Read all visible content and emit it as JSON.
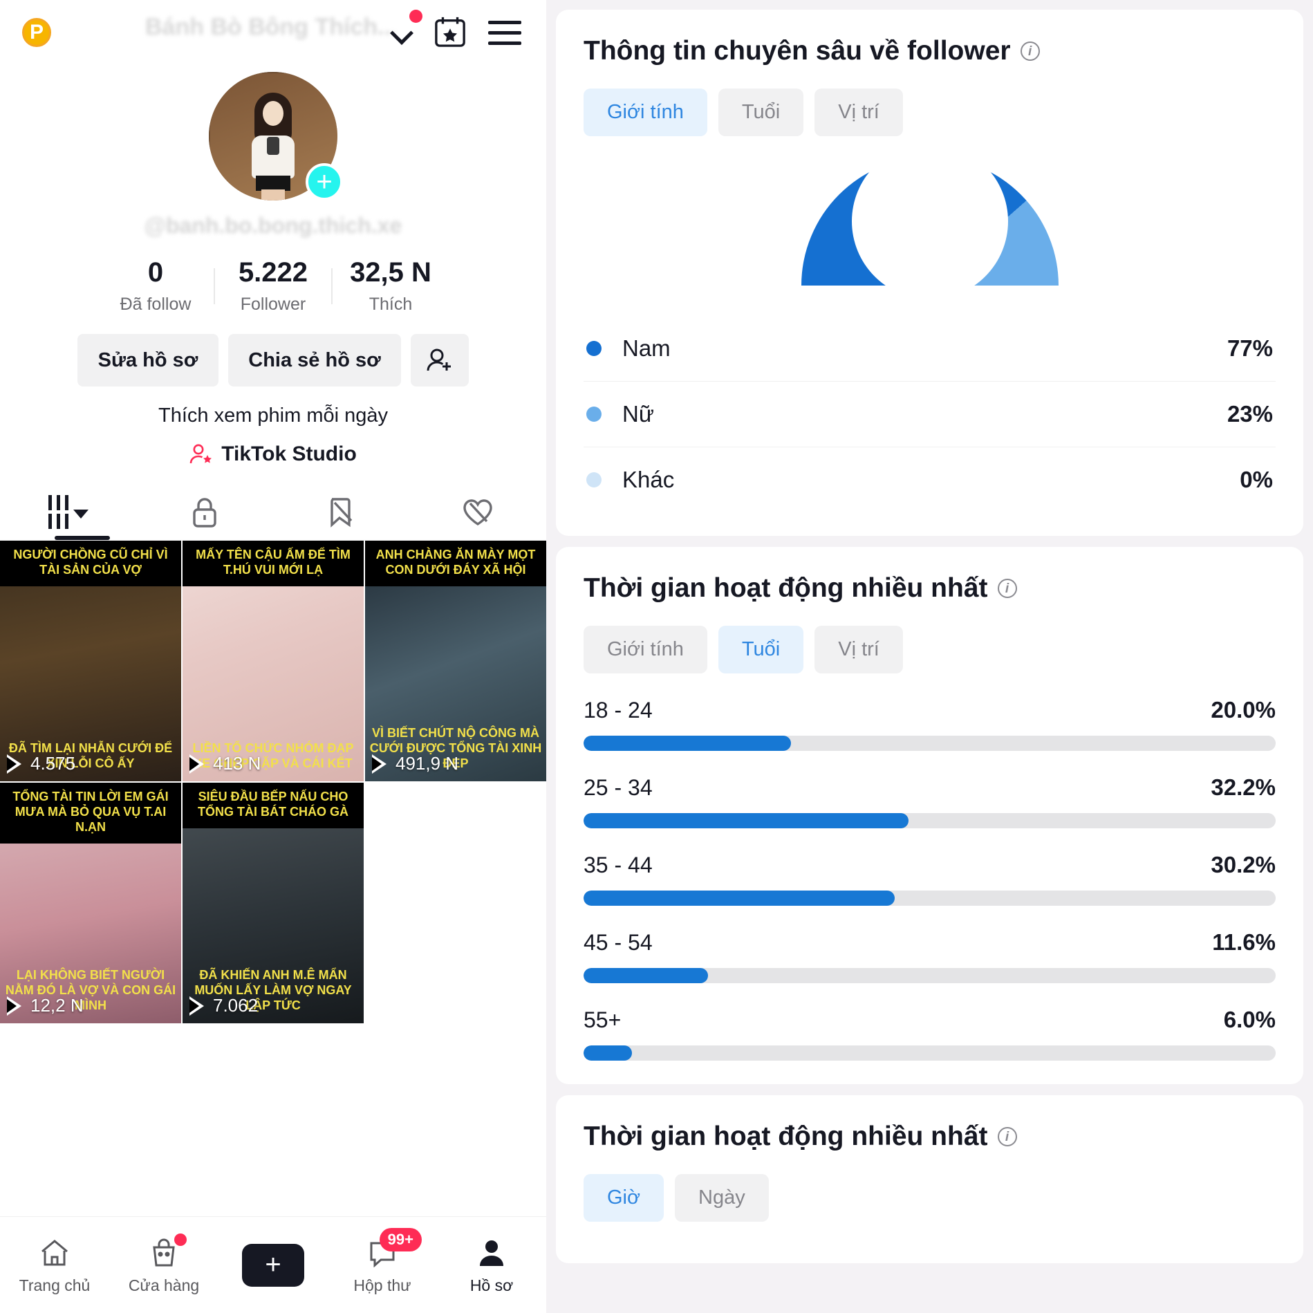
{
  "profile": {
    "pro_badge": "P",
    "title": "Bánh Bò Bông Thích...",
    "handle": "@banh.bo.bong.thich.xe",
    "icons": {
      "chevron": "chevron-down-icon",
      "calendar": "calendar-star-icon",
      "menu": "hamburger-menu-icon",
      "add": "plus-icon"
    },
    "stats": [
      {
        "value": "0",
        "label": "Đã follow"
      },
      {
        "value": "5.222",
        "label": "Follower"
      },
      {
        "value": "32,5 N",
        "label": "Thích"
      }
    ],
    "actions": {
      "edit": "Sửa hồ sơ",
      "share": "Chia sẻ hồ sơ",
      "add_friend_icon": "add-user-icon"
    },
    "bio": "Thích xem phim mỗi ngày",
    "studio_link": "TikTok Studio",
    "tabs": [
      {
        "name": "posts-tab",
        "icon": "grid-icon"
      },
      {
        "name": "private-tab",
        "icon": "lock-icon"
      },
      {
        "name": "saved-tab",
        "icon": "bookmark-off-icon"
      },
      {
        "name": "liked-tab",
        "icon": "heart-off-icon"
      }
    ]
  },
  "videos": [
    {
      "caption_top": "NGƯỜI CHỒNG CŨ CHỈ VÌ TÀI SẢN CỦA VỢ",
      "caption_bottom": "ĐÃ TÌM LẠI NHẪN CƯỚI ĐỂ XIN LỖI CÔ ẤY",
      "views": "4.575"
    },
    {
      "caption_top": "MẤY TÊN CẬU ẤM ĐỂ TÌM T.HÚ VUI MỚI LẠ",
      "caption_bottom": "LIỀN TỔ CHỨC NHÓM ĐẠP XE GHÉP CẶP VÀ CÁI KẾT",
      "views": "413 N"
    },
    {
      "caption_top": "ANH CHÀNG ĂN MÀY MỌT CON DƯỚI ĐÁY XÃ HỘI",
      "caption_bottom": "VÌ BIẾT CHÚT NỘ CÔNG MÀ CƯỚI ĐƯỢC TỔNG TÀI XINH ĐẸP",
      "views": "491,9 N"
    },
    {
      "caption_top": "TỔNG TÀI TIN LỜI EM GÁI MƯA MÀ BỎ QUA VỤ T.AI N.ẠN",
      "caption_bottom": "LẠI KHÔNG BIẾT NGƯỜI NẰM ĐÓ LÀ VỢ VÀ CON GÁI MÌNH",
      "views": "12,2 N"
    },
    {
      "caption_top": "SIÊU ĐẦU BẾP NẤU CHO TỔNG TÀI BÁT CHÁO GÀ",
      "caption_bottom": "ĐÃ KHIẾN ANH M.Ê MẨN MUỐN LẤY LÀM VỢ NGAY LẬP TỨC",
      "views": "7.062"
    }
  ],
  "bottom_nav": [
    {
      "label": "Trang chủ",
      "icon": "home-icon",
      "active": false
    },
    {
      "label": "Cửa hàng",
      "icon": "shop-bag-icon",
      "active": false,
      "dot": true
    },
    {
      "label": "",
      "icon": "create-plus-icon",
      "active": false
    },
    {
      "label": "Hộp thư",
      "icon": "inbox-icon",
      "active": false,
      "badge": "99+"
    },
    {
      "label": "Hồ sơ",
      "icon": "person-icon",
      "active": true
    }
  ],
  "analytics": {
    "follower_card": {
      "title": "Thông tin chuyên sâu về follower",
      "info_icon": "info-icon",
      "segments": [
        {
          "label": "Giới tính",
          "active": true
        },
        {
          "label": "Tuổi",
          "active": false
        },
        {
          "label": "Vị trí",
          "active": false
        }
      ]
    },
    "age_card": {
      "title": "Thời gian hoạt động nhiều nhất",
      "info_icon": "info-icon",
      "segments": [
        {
          "label": "Giới tính",
          "active": false
        },
        {
          "label": "Tuổi",
          "active": true
        },
        {
          "label": "Vị trí",
          "active": false
        }
      ]
    },
    "activity_card": {
      "title": "Thời gian hoạt động nhiều nhất",
      "info_icon": "info-icon",
      "segments": [
        {
          "label": "Giờ",
          "active": true
        },
        {
          "label": "Ngày",
          "active": false
        }
      ]
    }
  },
  "colors": {
    "blue_dark": "#1570d1",
    "blue_light": "#6aaeea",
    "blue_pale": "#cfe4f7",
    "accent_red": "#fe2c55",
    "accent_cyan": "#25f4ee",
    "track_gray": "#e4e4e6"
  },
  "chart_data": [
    {
      "type": "pie",
      "title": "Thông tin chuyên sâu về follower — Giới tính",
      "labels": [
        "Nam",
        "Nữ",
        "Khác"
      ],
      "values": [
        77,
        23,
        0
      ],
      "value_labels": [
        "77%",
        "23%",
        "0%"
      ],
      "colors": [
        "#1570d1",
        "#6aaeea",
        "#cfe4f7"
      ],
      "legend": "bottom",
      "shape": "semicircle-donut"
    },
    {
      "type": "bar",
      "orientation": "horizontal",
      "title": "Thời gian hoạt động nhiều nhất — Tuổi",
      "categories": [
        "18 - 24",
        "25 - 34",
        "35 - 44",
        "45 - 54",
        "55+"
      ],
      "values": [
        20.0,
        32.2,
        30.2,
        11.6,
        6.0
      ],
      "value_labels": [
        "20.0%",
        "32.2%",
        "30.2%",
        "11.6%",
        "6.0%"
      ],
      "bar_widths_pct": [
        30,
        47,
        45,
        18,
        7
      ],
      "xlabel": "",
      "ylabel": "",
      "xlim": [
        0,
        100
      ],
      "grid": false,
      "color": "#1778d4"
    }
  ]
}
